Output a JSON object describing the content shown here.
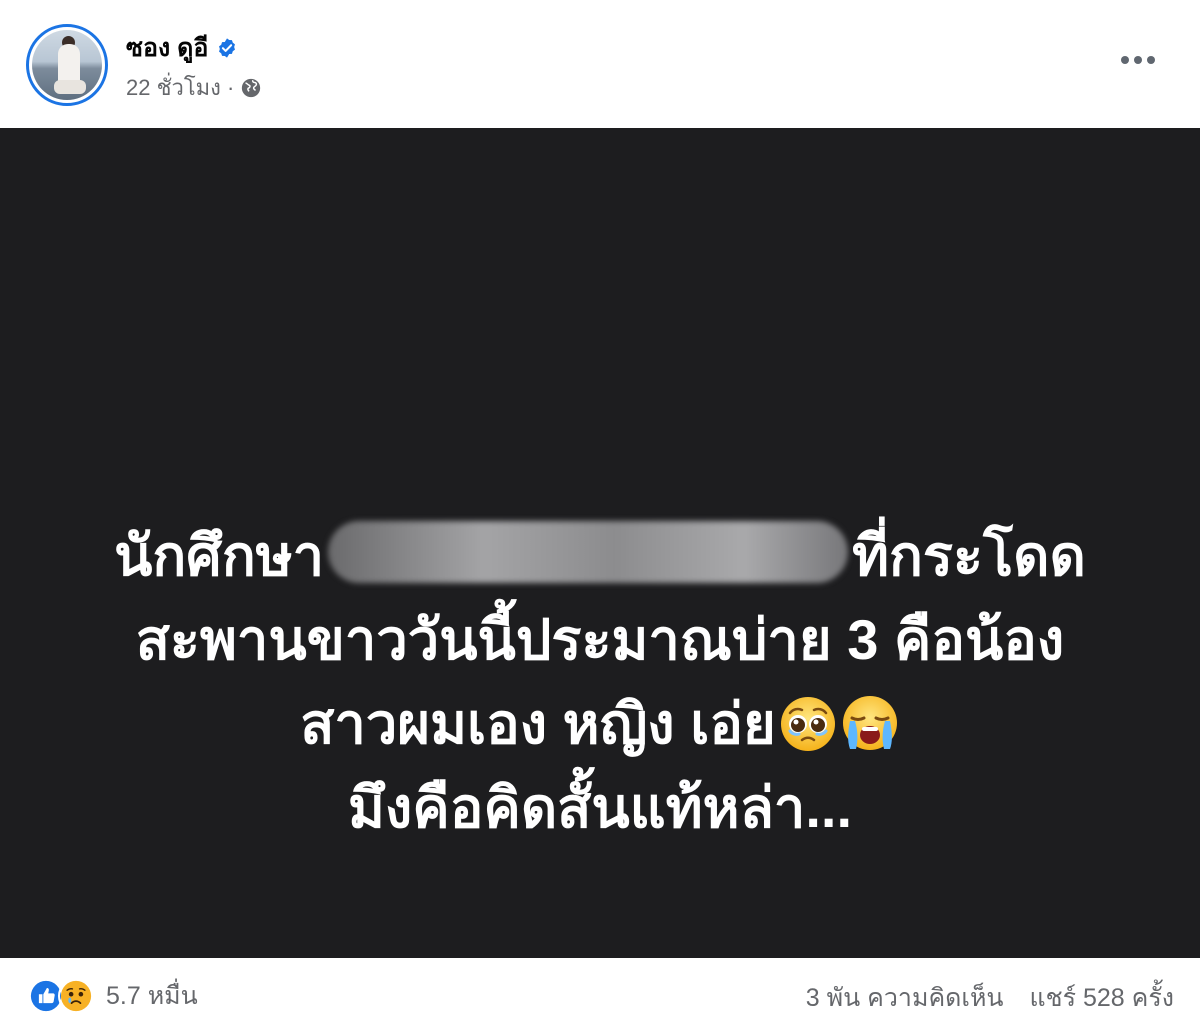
{
  "post": {
    "author_name": "ซอง ดูอี",
    "timestamp": "22 ชั่วโมง",
    "separator": "·",
    "audience_icon": "globe-icon",
    "verified_icon": "verified-badge-icon",
    "more_icon": "more-horizontal-icon"
  },
  "image": {
    "line1_start": "นักศึกษา",
    "line1_end": "ที่กระโดด",
    "line2": "สะพานขาววันนี้ประมาณบ่าย 3 คือน้อง",
    "line3": "สาวผมเอง หญิง เอ่ย",
    "line4": "มึงคือคิดสั้นแท้หล่า...",
    "emoji1": "pleading-face-icon",
    "emoji2": "loudly-crying-face-icon"
  },
  "footer": {
    "reactions": [
      "like-icon",
      "sad-icon"
    ],
    "reaction_count": "5.7 หมื่น",
    "comments": "3 พัน ความคิดเห็น",
    "shares": "แชร์ 528 ครั้ง"
  },
  "colors": {
    "accent": "#1b74e4",
    "image_background": "#1d1d1f",
    "secondary_text": "#65676b"
  }
}
